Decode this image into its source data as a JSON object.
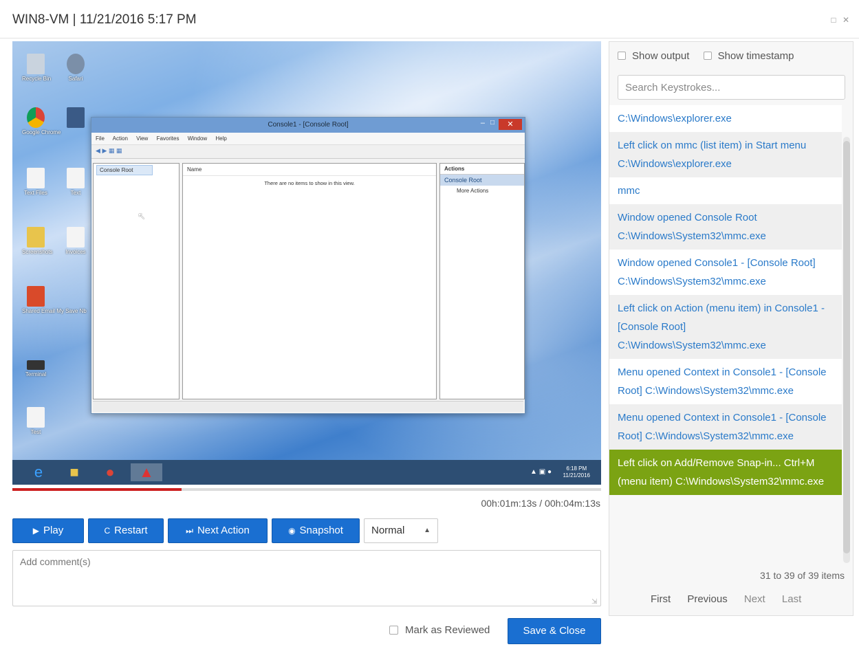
{
  "header": {
    "title": "WIN8-VM | 11/21/2016 5:17 PM"
  },
  "vm": {
    "mmc_title": "Console1 - [Console Root]",
    "mmc_menu": [
      "File",
      "Action",
      "View",
      "Favorites",
      "Window",
      "Help"
    ],
    "tree_root": "Console Root",
    "col_name": "Name",
    "empty_message": "There are no items to show in this view.",
    "actions_header": "Actions",
    "actions_root": "Console Root",
    "more_actions": "More Actions",
    "clock_time": "6:18 PM",
    "clock_date": "11/21/2016",
    "desktop_icons": [
      "Recycle Bin",
      "Safari",
      "Google Chrome",
      "",
      "Text Files",
      "Text",
      "Screenshots",
      "Invoices",
      "Shared Email My Save Nb",
      "",
      "Terminal",
      "Test"
    ]
  },
  "playback": {
    "progress": 0.287,
    "time": "00h:01m:13s / 00h:04m:13s",
    "play_label": "Play",
    "restart_label": "Restart",
    "next_label": "Next Action",
    "snapshot_label": "Snapshot",
    "speed": "Normal",
    "comment_placeholder": "Add comment(s)",
    "mark_reviewed": "Mark as Reviewed",
    "save_close": "Save & Close"
  },
  "panel": {
    "show_output": "Show output",
    "show_timestamp": "Show timestamp",
    "search_placeholder": "Search Keystrokes...",
    "items": [
      "C:\\Windows\\explorer.exe",
      "Left click on mmc (list item) in Start menu C:\\Windows\\explorer.exe",
      "mmc",
      "Window opened Console Root C:\\Windows\\System32\\mmc.exe",
      "Window opened Console1 - [Console Root] C:\\Windows\\System32\\mmc.exe",
      "Left click on Action (menu item) in Console1 - [Console Root] C:\\Windows\\System32\\mmc.exe",
      "Menu opened Context in Console1 - [Console Root] C:\\Windows\\System32\\mmc.exe",
      "Menu opened Context in Console1 - [Console Root] C:\\Windows\\System32\\mmc.exe",
      "Left click on Add/Remove Snap-in... Ctrl+M (menu item) C:\\Windows\\System32\\mmc.exe"
    ],
    "pager_info": "31 to 39 of 39 items",
    "pager": {
      "first": "First",
      "previous": "Previous",
      "next": "Next",
      "last": "Last"
    }
  },
  "colors": {
    "accent": "#1a6fd1",
    "selected": "#7ba313",
    "progress": "#cc1f1f"
  }
}
